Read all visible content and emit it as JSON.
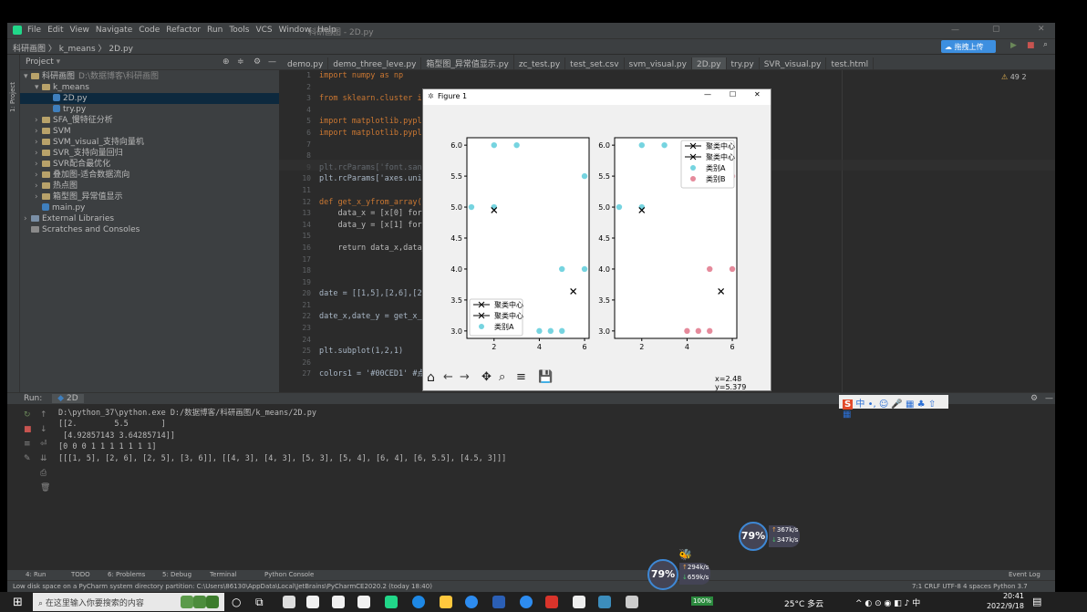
{
  "titlebar": {
    "menus": [
      "File",
      "Edit",
      "View",
      "Navigate",
      "Code",
      "Refactor",
      "Run",
      "Tools",
      "VCS",
      "Window",
      "Help"
    ],
    "project_title": "科研画图 - 2D.py",
    "upload_btn": "拖拽上传"
  },
  "breadcrumb": [
    "科研画图",
    "k_means",
    "2D.py"
  ],
  "project": {
    "header": "Project",
    "items": [
      {
        "label": "科研画图",
        "suffix": "D:\\数据博客\\科研画图",
        "indent": 0,
        "type": "folder"
      },
      {
        "label": "k_means",
        "indent": 1,
        "type": "folder"
      },
      {
        "label": "2D.py",
        "indent": 2,
        "type": "py",
        "selected": true
      },
      {
        "label": "try.py",
        "indent": 2,
        "type": "py"
      },
      {
        "label": "SFA_慢特征分析",
        "indent": 1,
        "type": "folder"
      },
      {
        "label": "SVM",
        "indent": 1,
        "type": "folder"
      },
      {
        "label": "SVM_visual_支持向量机",
        "indent": 1,
        "type": "folder"
      },
      {
        "label": "SVR_支持向量回归",
        "indent": 1,
        "type": "folder"
      },
      {
        "label": "SVR配合最优化",
        "indent": 1,
        "type": "folder"
      },
      {
        "label": "叠加图-适合数据流向",
        "indent": 1,
        "type": "folder"
      },
      {
        "label": "热点图",
        "indent": 1,
        "type": "folder"
      },
      {
        "label": "箱型图_异常值显示",
        "indent": 1,
        "type": "folder"
      },
      {
        "label": "main.py",
        "indent": 1,
        "type": "py"
      },
      {
        "label": "External Libraries",
        "indent": 0,
        "type": "lib"
      },
      {
        "label": "Scratches and Consoles",
        "indent": 0,
        "type": "scratch"
      }
    ]
  },
  "tabs": [
    "demo.py",
    "demo_three_leve.py",
    "箱型图_异常值显示.py",
    "zc_test.py",
    "test_set.csv",
    "svm_visual.py",
    "2D.py",
    "try.py",
    "SVR_visual.py",
    "test.html"
  ],
  "active_tab": "2D.py",
  "inspection": "49  2",
  "code_lines": [
    "1",
    "2",
    "3",
    "4",
    "5",
    "6",
    "7",
    "8",
    "9",
    "10",
    "11",
    "12",
    "13",
    "14",
    "15",
    "16",
    "17",
    "18",
    "19",
    "20",
    "21",
    "22",
    "23",
    "24",
    "25",
    "26",
    "27"
  ],
  "code": [
    "import numpy as np",
    "",
    "from sklearn.cluster impo",
    "",
    "import matplotlib.pyplot",
    "import matplotlib.pyplot",
    "",
    "",
    "plt.rcParams['font.sans-s",
    "plt.rcParams['axes.unicod",
    "",
    "def get_x_yfrom_array(dat",
    "    data_x = [x[0] for x",
    "    data_y = [x[1] for x",
    "",
    "    return data_x,data_y",
    "",
    "",
    "",
    "date = [[1,5],[2,6],[2,5]",
    "",
    "date_x,date_y = get_x_yfr",
    "",
    "",
    "plt.subplot(1,2,1)",
    "",
    "colors1 = '#00CED1' #点的"
  ],
  "run": {
    "label": "Run:",
    "tab": "2D",
    "console": [
      "D:\\python_37\\python.exe D:/数据博客/科研画图/k_means/2D.py",
      "[[2.        5.5       ]",
      " [4.92857143 3.64285714]]",
      "[0 0 0 1 1 1 1 1 1 1]",
      "[[[1, 5], [2, 6], [2, 5], [3, 6]], [[4, 3], [4, 3], [5, 3], [5, 4], [6, 4], [6, 5.5], [4.5, 3]]]"
    ]
  },
  "bottom_tabs": [
    "4: Run",
    "TODO",
    "6: Problems",
    "5: Debug",
    "Terminal",
    "Python Console",
    "Event Log"
  ],
  "status": {
    "message": "Low disk space on a PyCharm system directory partition: C:\\Users\\86130\\AppData\\Local\\JetBrains\\PyCharmCE2020.2 (today 18:40)",
    "right": "7:1  CRLF  UTF-8  4 spaces  Python 3.7"
  },
  "figure": {
    "title": "Figure 1",
    "coords": "x=2.48 y=5.379"
  },
  "chart_data": [
    {
      "type": "scatter",
      "xlim": [
        0.8,
        6.2
      ],
      "ylim": [
        2.88,
        6.12
      ],
      "xticks": [
        2,
        4,
        6
      ],
      "yticks": [
        3.0,
        3.5,
        4.0,
        4.5,
        5.0,
        5.5,
        6.0
      ],
      "series": [
        {
          "name": "类别A",
          "color": "#76d4e0",
          "points": [
            [
              1,
              5
            ],
            [
              2,
              6
            ],
            [
              2,
              5
            ],
            [
              3,
              6
            ],
            [
              4,
              3
            ],
            [
              4.5,
              3
            ],
            [
              5,
              3
            ],
            [
              5,
              4
            ],
            [
              6,
              4
            ],
            [
              6,
              5.5
            ]
          ]
        },
        {
          "name": "聚类中心",
          "color": "#000000",
          "marker": "x",
          "points": [
            [
              2,
              4.95
            ],
            [
              5.5,
              3.64
            ]
          ]
        }
      ],
      "legend": [
        "聚类中心",
        "聚类中心",
        "类别A"
      ],
      "legend_loc": "lower-left"
    },
    {
      "type": "scatter",
      "xlim": [
        0.8,
        6.2
      ],
      "ylim": [
        2.88,
        6.12
      ],
      "xticks": [
        2,
        4,
        6
      ],
      "yticks": [
        3.0,
        3.5,
        4.0,
        4.5,
        5.0,
        5.5,
        6.0
      ],
      "series": [
        {
          "name": "类别A",
          "color": "#76d4e0",
          "points": [
            [
              1,
              5
            ],
            [
              2,
              6
            ],
            [
              2,
              5
            ],
            [
              3,
              6
            ]
          ]
        },
        {
          "name": "类别B",
          "color": "#e58a9b",
          "points": [
            [
              4,
              3
            ],
            [
              4.5,
              3
            ],
            [
              5,
              3
            ],
            [
              5,
              4
            ],
            [
              6,
              4
            ],
            [
              6,
              5.5
            ]
          ]
        },
        {
          "name": "聚类中心",
          "color": "#000000",
          "marker": "x",
          "points": [
            [
              2,
              4.95
            ],
            [
              5.5,
              3.64
            ]
          ]
        }
      ],
      "legend": [
        "聚类中心",
        "聚类中心",
        "类别A",
        "类别B"
      ],
      "legend_loc": "upper-right"
    }
  ],
  "monitor": {
    "cpu1": "79%",
    "up1": "367k/s",
    "down1": "347k/s",
    "cpu2": "79%",
    "up2": "294k/s",
    "down2": "659k/s"
  },
  "ime": "中",
  "taskbar": {
    "search": "在这里输入你要搜索的内容",
    "weather": "25°C 多云",
    "time": "20:41",
    "date": "2022/9/18",
    "battery": "100%"
  }
}
